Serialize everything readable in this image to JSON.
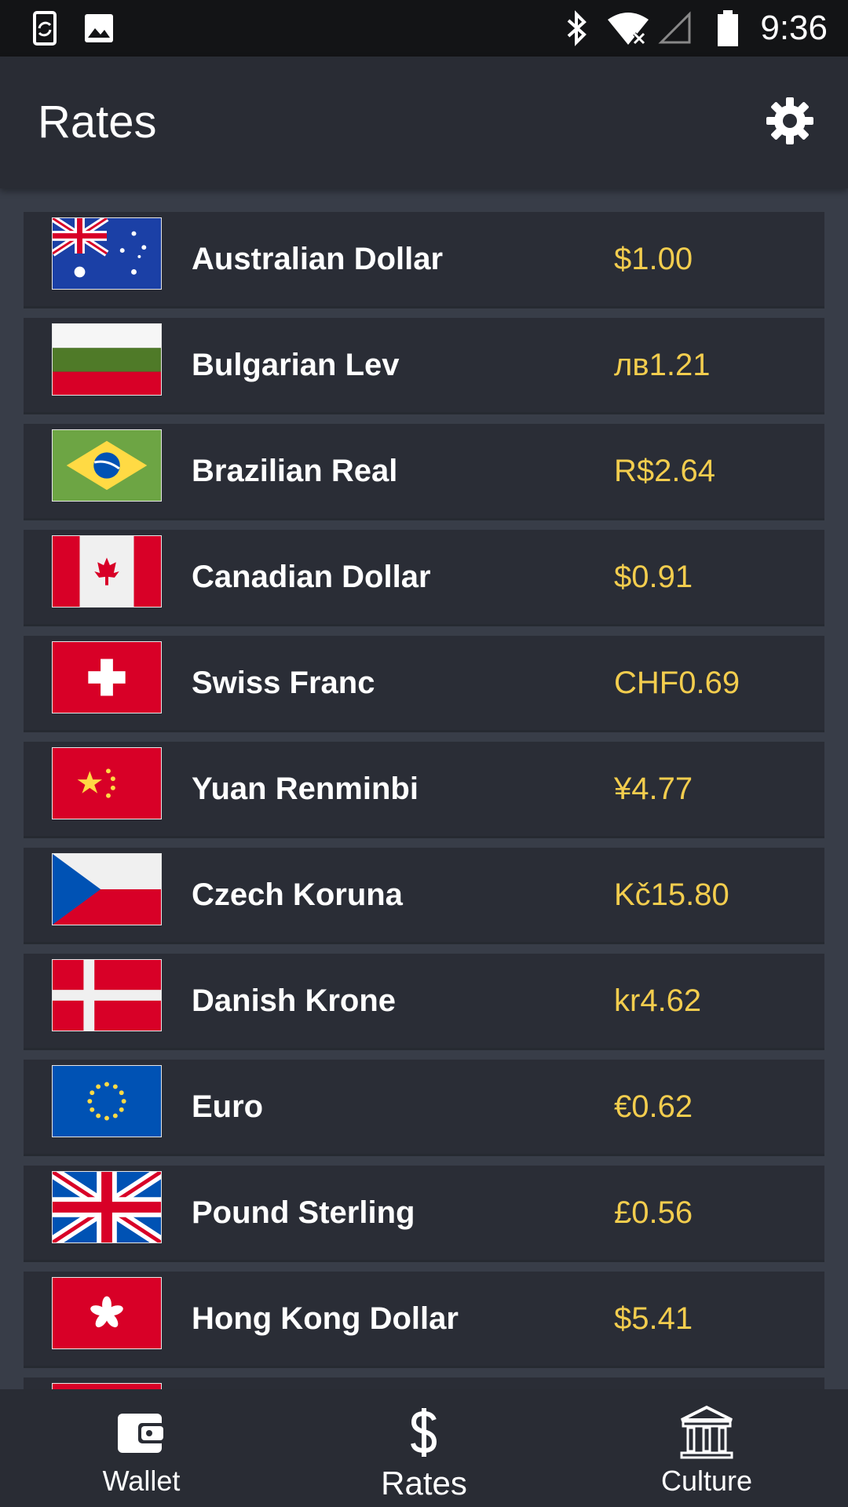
{
  "status_bar": {
    "time": "9:36",
    "icons": [
      "screen-rotation-icon",
      "image-icon",
      "bluetooth-icon",
      "wifi-off-icon",
      "cell-signal-icon",
      "battery-icon"
    ]
  },
  "app_bar": {
    "title": "Rates",
    "settings_icon": "gear-icon"
  },
  "currencies": [
    {
      "name": "Australian Dollar",
      "rate": "$1.00",
      "flag": "australia"
    },
    {
      "name": "Bulgarian Lev",
      "rate": "лв1.21",
      "flag": "bulgaria"
    },
    {
      "name": "Brazilian Real",
      "rate": "R$2.64",
      "flag": "brazil"
    },
    {
      "name": "Canadian Dollar",
      "rate": "$0.91",
      "flag": "canada"
    },
    {
      "name": "Swiss Franc",
      "rate": "CHF0.69",
      "flag": "switzerland"
    },
    {
      "name": "Yuan Renminbi",
      "rate": "¥4.77",
      "flag": "china"
    },
    {
      "name": "Czech Koruna",
      "rate": "Kč15.80",
      "flag": "czech"
    },
    {
      "name": "Danish Krone",
      "rate": "kr4.62",
      "flag": "denmark"
    },
    {
      "name": "Euro",
      "rate": "€0.62",
      "flag": "eu"
    },
    {
      "name": "Pound Sterling",
      "rate": "£0.56",
      "flag": "uk"
    },
    {
      "name": "Hong Kong Dollar",
      "rate": "$5.41",
      "flag": "hongkong"
    }
  ],
  "bottom_nav": {
    "items": [
      {
        "label": "Wallet",
        "icon": "wallet-icon"
      },
      {
        "label": "Rates",
        "icon": "dollar-icon",
        "active": true
      },
      {
        "label": "Culture",
        "icon": "museum-icon"
      }
    ]
  },
  "colors": {
    "background": "#383d48",
    "card": "#2a2d36",
    "app_bar": "#292c34",
    "rate_text": "#f3cd4e"
  }
}
